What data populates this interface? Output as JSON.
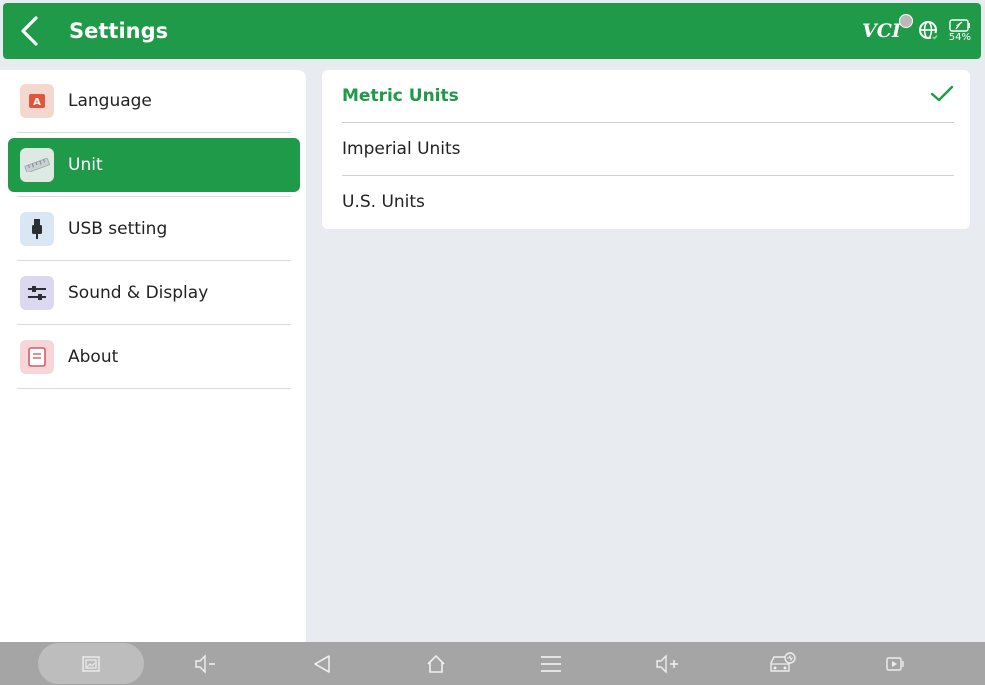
{
  "header": {
    "title": "Settings",
    "vci_label": "VCI",
    "battery_percent": "54%"
  },
  "sidebar": {
    "items": [
      {
        "label": "Language",
        "icon": "language-icon"
      },
      {
        "label": "Unit",
        "icon": "ruler-icon",
        "active": true
      },
      {
        "label": "USB setting",
        "icon": "usb-icon"
      },
      {
        "label": "Sound & Display",
        "icon": "sliders-icon"
      },
      {
        "label": "About",
        "icon": "document-icon"
      }
    ]
  },
  "units": {
    "options": [
      {
        "label": "Metric Units",
        "selected": true
      },
      {
        "label": "Imperial Units",
        "selected": false
      },
      {
        "label": "U.S. Units",
        "selected": false
      }
    ]
  },
  "colors": {
    "accent": "#1f9a49",
    "background": "#e8ecf1",
    "navbar": "#a5a5a5"
  },
  "navbar": {
    "buttons": [
      "screenshot-icon",
      "volume-down-icon",
      "back-triangle-icon",
      "home-icon",
      "recent-apps-icon",
      "volume-up-icon",
      "vehicle-diagnostics-icon",
      "screen-record-icon"
    ]
  }
}
